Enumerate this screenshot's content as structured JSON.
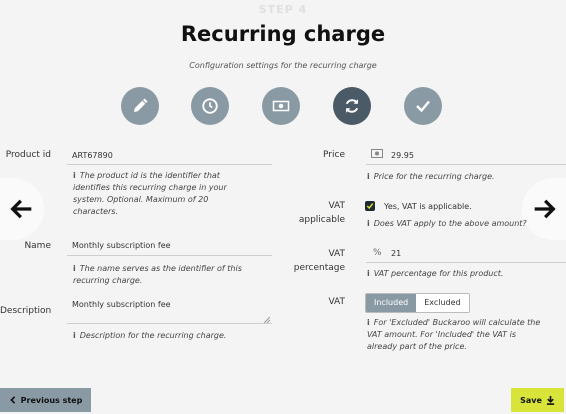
{
  "header": {
    "step": "STEP 4",
    "title": "Recurring charge",
    "subtitle": "Configuration settings for the recurring charge"
  },
  "steps": [
    {
      "icon": "pencil-icon"
    },
    {
      "icon": "clock-icon"
    },
    {
      "icon": "money-icon"
    },
    {
      "icon": "refresh-icon",
      "active": true
    },
    {
      "icon": "check-icon"
    }
  ],
  "fields": {
    "product_id": {
      "label": "Product id",
      "value": "ART67890",
      "help_lines": [
        "The product id is the identifier that",
        "identifies this recurring charge in your",
        "system. Optional. Maximum of 20",
        "characters."
      ]
    },
    "name": {
      "label": "Name",
      "value": "Monthly subscription fee",
      "help_lines": [
        "The name serves as the identifier of this",
        "recurring charge."
      ]
    },
    "description": {
      "label": "Description",
      "value": "Monthly subscription fee",
      "help_lines": [
        "Description for the recurring charge."
      ]
    },
    "price": {
      "label": "Price",
      "value": "29.95",
      "help_lines": [
        "Price for the recurring charge."
      ]
    },
    "vat_applicable": {
      "label_lines": [
        "VAT",
        "applicable"
      ],
      "checkbox_label": "Yes, VAT is applicable.",
      "checked": true,
      "help_lines": [
        "Does VAT apply to the above amount?"
      ]
    },
    "vat_percentage": {
      "label_lines": [
        "VAT",
        "percentage"
      ],
      "prefix": "%",
      "value": "21",
      "help_lines": [
        "VAT percentage for this product."
      ]
    },
    "vat": {
      "label": "VAT",
      "options": [
        "Included",
        "Excluded"
      ],
      "selected": "Included",
      "help_lines": [
        "For 'Excluded' Buckaroo will calculate the",
        "VAT amount. For 'Included' the VAT is",
        "already part of the price."
      ]
    }
  },
  "nav": {
    "prev_icon": "arrow-left-icon",
    "next_icon": "arrow-right-icon"
  },
  "footer": {
    "previous_label": "Previous step",
    "save_label": "Save"
  },
  "colors": {
    "step_icon": "#8a9aa5",
    "step_icon_active": "#4a5a66",
    "save_button": "#d8e43a",
    "background": "#f4f4f4"
  }
}
